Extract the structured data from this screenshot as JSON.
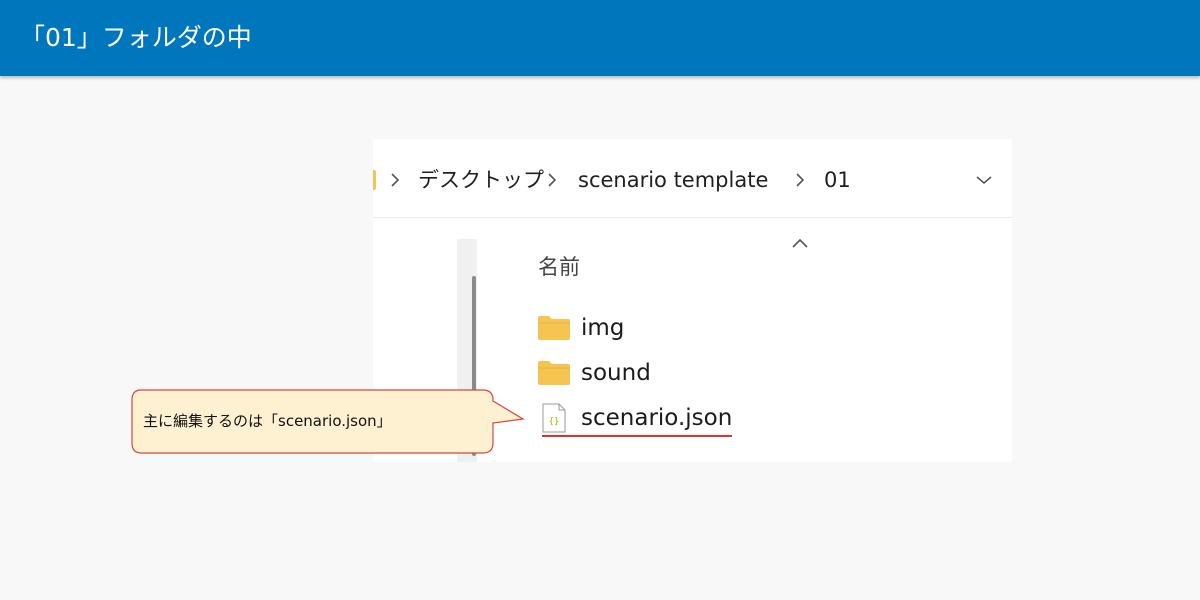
{
  "header": {
    "title": "「01」フォルダの中"
  },
  "explorer": {
    "breadcrumb": [
      "デスクトップ",
      "scenario template",
      "01"
    ],
    "column_header": "名前",
    "files": [
      {
        "name": "img",
        "icon": "folder-icon"
      },
      {
        "name": "sound",
        "icon": "folder-icon"
      },
      {
        "name": "scenario.json",
        "icon": "json-file-icon"
      }
    ]
  },
  "callout": {
    "text": "主に編集するのは「scenario.json」"
  },
  "colors": {
    "header_bg": "#0077bd",
    "folder": "#f5c451",
    "highlight_underline": "#e0312e",
    "callout_bg": "#fef1d2",
    "callout_border": "#d9463c"
  }
}
